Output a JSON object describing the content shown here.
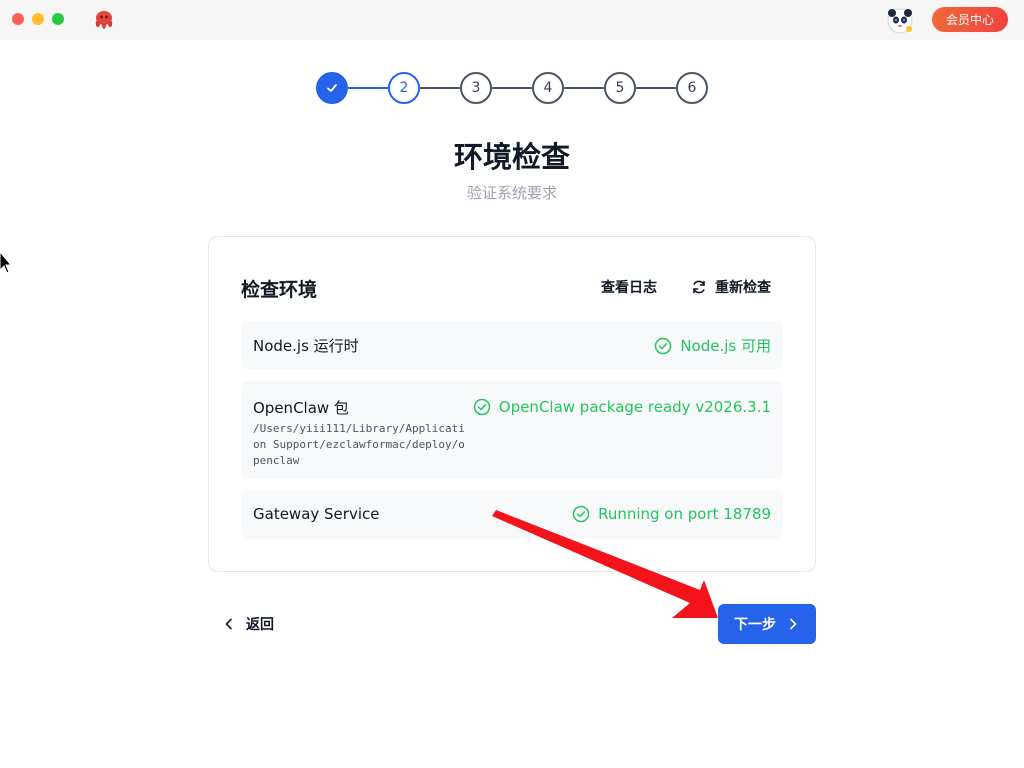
{
  "titlebar": {
    "window_controls": [
      "close",
      "minimize",
      "maximize"
    ],
    "app_icon": "octopus-logo-icon",
    "avatar_icon": "panda-avatar-icon",
    "vip_label": "会员中心"
  },
  "stepper": {
    "steps": [
      {
        "label": "✓",
        "state": "done"
      },
      {
        "label": "2",
        "state": "active"
      },
      {
        "label": "3",
        "state": "pending"
      },
      {
        "label": "4",
        "state": "pending"
      },
      {
        "label": "5",
        "state": "pending"
      },
      {
        "label": "6",
        "state": "pending"
      }
    ]
  },
  "page": {
    "title": "环境检查",
    "subtitle": "验证系统要求"
  },
  "card": {
    "title": "检查环境",
    "log_label": "查看日志",
    "recheck_label": "重新检查",
    "checks": [
      {
        "name": "Node.js 运行时",
        "status": "Node.js 可用"
      },
      {
        "name": "OpenClaw 包",
        "path": "/Users/yiii111/Library/Application Support/ezclawformac/deploy/openclaw",
        "status": "OpenClaw package ready v2026.3.1"
      },
      {
        "name": "Gateway Service",
        "status": "Running on port 18789"
      }
    ]
  },
  "nav": {
    "back_label": "返回",
    "next_label": "下一步"
  },
  "colors": {
    "accent": "#2563eb",
    "success": "#22c55e",
    "vip_gradient_start": "#f0683a",
    "vip_gradient_end": "#f2433f",
    "annotation_arrow": "#f2141a"
  }
}
